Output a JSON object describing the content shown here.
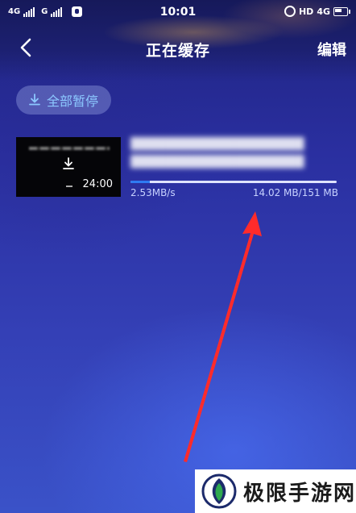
{
  "status_bar": {
    "left_network_1": "4G",
    "left_network_2": "G",
    "time": "10:01",
    "right_hd": "HD",
    "right_network": "4G"
  },
  "title_bar": {
    "title": "正在缓存",
    "edit_label": "编辑",
    "back_icon": "chevron-left-icon"
  },
  "pause_all": {
    "label": "全部暂停",
    "icon": "download-icon"
  },
  "downloads": [
    {
      "title_line_1": "████████████████████",
      "title_line_2": "████████████████████",
      "duration": "24:00",
      "speed": "2.53MB/s",
      "size": "14.02 MB/151 MB",
      "progress": 0.093
    }
  ],
  "colors": {
    "accent_blue": "#2f7bf3",
    "annotation_red": "#ff2b2b",
    "pause_text": "#8cc8ff"
  },
  "watermark": {
    "text": "极限手游网"
  }
}
